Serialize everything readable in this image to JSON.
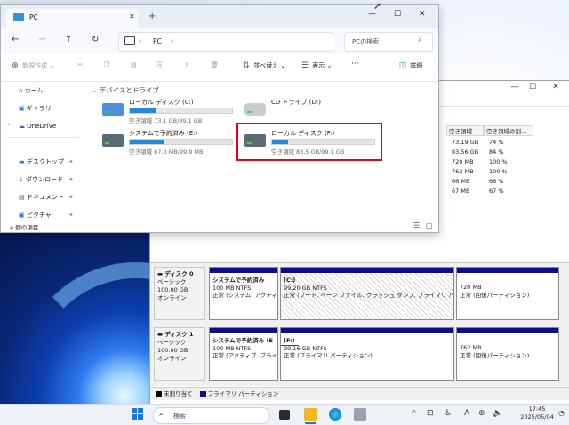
{
  "explorer": {
    "tab_title": "PC",
    "tab_add": "+",
    "window_controls": [
      "—",
      "☐",
      "✕"
    ],
    "breadcrumb": [
      "PC"
    ],
    "search_placeholder": "PCの検索",
    "commands": {
      "new": "新規作成",
      "sort": "並べ替え",
      "view": "表示",
      "more": "···",
      "details": "詳細"
    },
    "nav": {
      "home": "ホーム",
      "gallery": "ギャラリー",
      "onedrive": "OneDrive",
      "desktop": "デスクトップ",
      "downloads": "ダウンロード",
      "documents": "ドキュメント",
      "pictures": "ピクチャ"
    },
    "section_title": "デバイスとドライブ",
    "drives": [
      {
        "name": "ローカル ディスク (C:)",
        "free": "空き領域 73.1 GB/99.1 GB",
        "used_fraction": 0.26
      },
      {
        "name": "CD ドライブ (D:)",
        "free": "",
        "used_fraction": null
      },
      {
        "name": "システムで予約済み (E:)",
        "free": "空き領域 67.0 MB/99.9 MB",
        "used_fraction": 0.33
      },
      {
        "name": "ローカル ディスク (F:)",
        "free": "空き領域 83.5 GB/99.1 GB",
        "used_fraction": 0.16
      }
    ],
    "status": "4 個の項目"
  },
  "disk_management": {
    "window_controls": [
      "—",
      "☐",
      "✕"
    ],
    "table": {
      "headers": [
        "空き領域",
        "空き領域の割..."
      ],
      "rows": [
        [
          "73.19 GB",
          "74 %"
        ],
        [
          "83.56 GB",
          "84 %"
        ],
        [
          "720 MB",
          "100 %"
        ],
        [
          "762 MB",
          "100 %"
        ],
        [
          "66 MB",
          "66 %"
        ],
        [
          "67 MB",
          "67 %"
        ]
      ]
    },
    "disks": [
      {
        "label": "ディスク 0",
        "type": "ベーシック",
        "size": "100.00 GB",
        "state": "オンライン",
        "partitions": [
          {
            "title": "システムで予約済み",
            "size": "100 MB NTFS",
            "status": "正常 (システム, アクティ"
          },
          {
            "title": "(C:)",
            "size": "99.20 GB NTFS",
            "status": "正常 (ブート, ページ ファイル, クラッシュ ダンプ, プライマリ パーティ"
          },
          {
            "title": "",
            "size": "720 MB",
            "status": "正常 (回復パーティション)"
          }
        ]
      },
      {
        "label": "ディスク 1",
        "type": "ベーシック",
        "size": "100.00 GB",
        "state": "オンライン",
        "partitions": [
          {
            "title": "システムで予約済み (E",
            "size": "100 MB NTFS",
            "status": "正常 (アクティブ, プライマ"
          },
          {
            "title": "(F:)",
            "size": "99.16 GB NTFS",
            "status": "正常 (プライマリ パーティション)"
          },
          {
            "title": "",
            "size": "762 MB",
            "status": "正常 (回復パーティション)"
          }
        ]
      }
    ],
    "legend": [
      "未割り当て",
      "プライマリ パーティション"
    ]
  },
  "taskbar": {
    "search_placeholder": "検索",
    "tray_a": "A",
    "clock_time": "17:45",
    "clock_date": "2025/05/04"
  },
  "colors": {
    "accent": "#2689d8",
    "highlight_box": "#e60012",
    "partition_header": "#0c0c8c"
  }
}
